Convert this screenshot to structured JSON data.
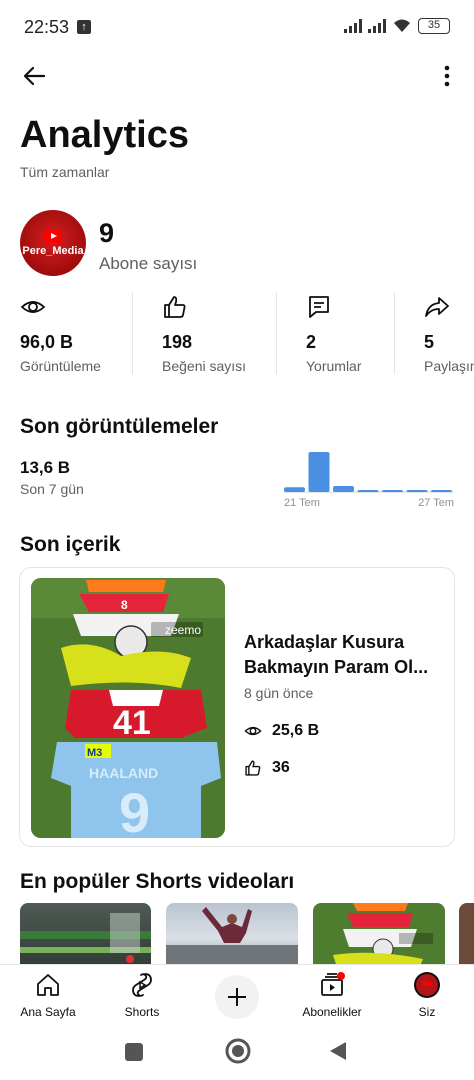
{
  "status_bar": {
    "time": "22:53",
    "battery": "35"
  },
  "page": {
    "title": "Analytics",
    "subtitle": "Tüm zamanlar"
  },
  "channel": {
    "avatar_label": "Pere_Media",
    "subscriber_count": "9",
    "subscriber_label": "Abone sayısı"
  },
  "stats": [
    {
      "icon": "eye-icon",
      "value": "96,0 B",
      "label": "Görüntüleme"
    },
    {
      "icon": "thumbs-up-icon",
      "value": "198",
      "label": "Beğeni sayısı"
    },
    {
      "icon": "comment-icon",
      "value": "2",
      "label": "Yorumlar"
    },
    {
      "icon": "share-icon",
      "value": "5",
      "label": "Paylaşım"
    }
  ],
  "recent_views": {
    "title": "Son görüntülemeler",
    "value": "13,6 B",
    "period": "Son 7 gün",
    "chart_start_label": "21 Tem",
    "chart_end_label": "27 Tem",
    "bar_levels": [
      0.12,
      1.0,
      0.15,
      0.04,
      0.03,
      0.03,
      0.03
    ]
  },
  "recent_content": {
    "title": "Son içerik",
    "video_title_line1": "Arkadaşlar Kusura",
    "video_title_line2": "Bakmayın Param Ol...",
    "age": "8 gün önce",
    "views": "25,6 B",
    "likes": "36",
    "watermark": "zeemo"
  },
  "popular": {
    "title": "En popüler Shorts videoları"
  },
  "nav": {
    "home": "Ana Sayfa",
    "shorts": "Shorts",
    "subscriptions": "Abonelikler",
    "you": "Siz"
  },
  "colors": {
    "accent_red": "#ff0000",
    "chart_blue": "#4a90e2",
    "text_secondary": "#606060"
  }
}
